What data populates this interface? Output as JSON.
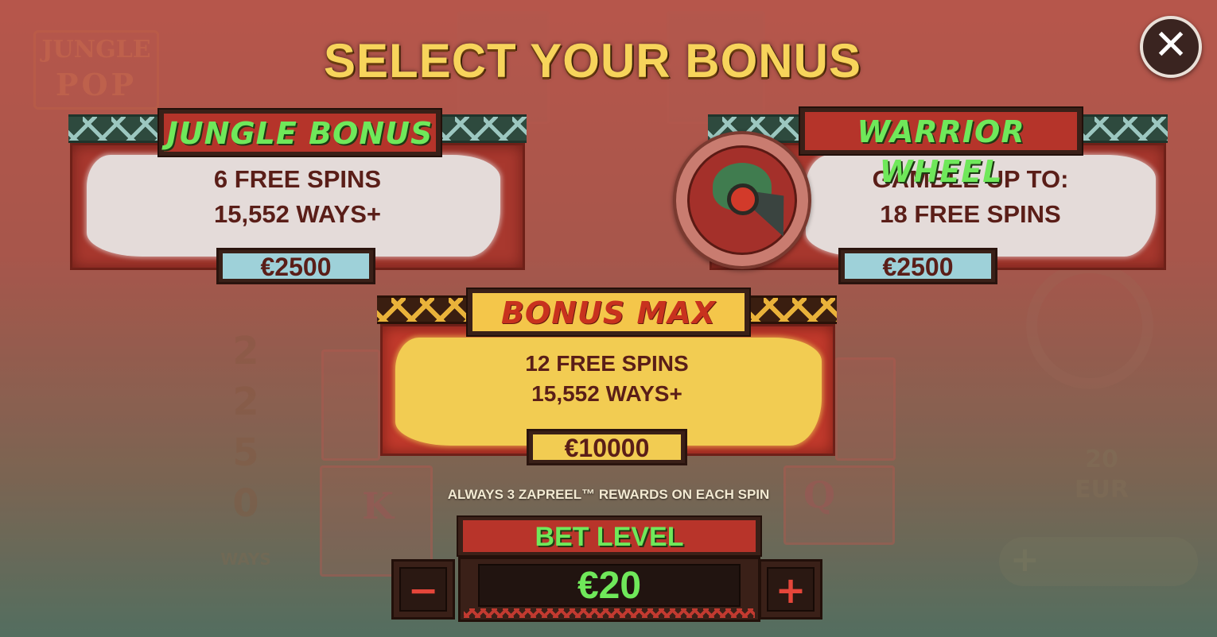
{
  "title": "SELECT YOUR BONUS",
  "close_icon": "close-icon",
  "background": {
    "logo_line1": "JUNGLE",
    "logo_line2": "POP",
    "column_digits": "2250",
    "column_caption": "WAYS",
    "letter_k": "K",
    "letter_q": "Q",
    "bet_value": "20",
    "bet_currency": "EUR",
    "plus_symbol": "+"
  },
  "bonuses": {
    "jungle": {
      "name": "JUNGLE BONUS",
      "line1": "6 FREE SPINS",
      "line2": "15,552 WAYS+",
      "price": "€2500"
    },
    "warrior": {
      "name": "WARRIOR WHEEL",
      "line1": "GAMBLE UP TO:",
      "line2": "18 FREE SPINS",
      "price": "€2500",
      "wheel_icon": "warrior-wheel-icon"
    },
    "max": {
      "name": "BONUS MAX",
      "line1": "12 FREE SPINS",
      "line2": "15,552 WAYS+",
      "price": "€10000"
    }
  },
  "rewards_note": "ALWAYS 3 ZAPREEL™ REWARDS ON EACH SPIN",
  "bet": {
    "label": "BET LEVEL",
    "value": "€20",
    "minus": "−",
    "plus": "+"
  },
  "colors": {
    "title": "#f7d45b",
    "green_text": "#6fe85a",
    "red_text": "#c8321e",
    "board_red": "#a8382e",
    "price_blue": "#9ed1d9",
    "price_yellow": "#f2cc52"
  }
}
